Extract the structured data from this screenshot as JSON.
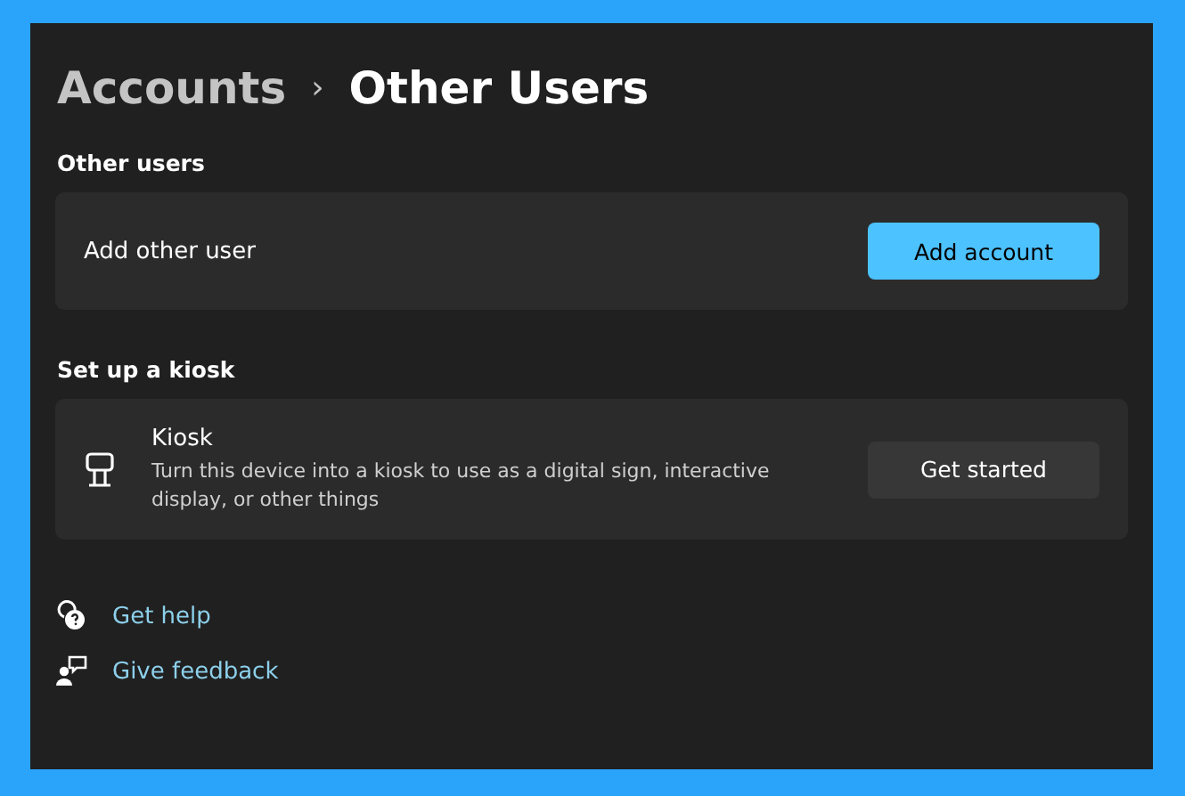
{
  "breadcrumb": {
    "parent": "Accounts",
    "separator": "›",
    "current": "Other Users"
  },
  "sections": [
    {
      "heading": "Other users",
      "card": {
        "kind": "simple",
        "title": "Add other user",
        "button": {
          "label": "Add account",
          "kind": "primary"
        }
      }
    },
    {
      "heading": "Set up a kiosk",
      "card": {
        "kind": "icon",
        "title": "Kiosk",
        "description": "Turn this device into a kiosk to use as a digital sign, interactive display, or other things",
        "button": {
          "label": "Get started",
          "kind": "secondary"
        }
      }
    }
  ],
  "links": [
    {
      "label": "Get help",
      "kind": "help"
    },
    {
      "label": "Give feedback",
      "kind": "feedback"
    }
  ]
}
